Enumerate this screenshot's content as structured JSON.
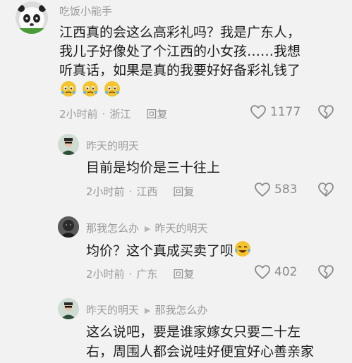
{
  "comments": [
    {
      "user": "吃饭小能手",
      "lines": [
        "江西真的会这么高彩礼吗？我是广东人，",
        "我儿子好像处了个江西的小女孩……我想",
        "听真话，如果是真的我要好好备彩礼钱了"
      ],
      "emoji_names": [
        "worried-face-emoji",
        "worried-face-emoji",
        "worried-face-emoji"
      ],
      "time": "2小时前",
      "location": "浙江",
      "reply": "回复",
      "likes": "1177"
    },
    {
      "user": "昨天的明天",
      "lines": [
        "目前是均价是三十往上"
      ],
      "time": "2小时前",
      "location": "江西",
      "reply": "回复",
      "likes": "583"
    },
    {
      "user": "那我怎么办",
      "reply_to": "昨天的明天",
      "lines": [
        "均价？这个真成买卖了呗"
      ],
      "emoji_names": [
        "tears-of-joy-emoji"
      ],
      "time": "2小时前",
      "location": "广东",
      "reply": "回复",
      "likes": "402"
    },
    {
      "user": "昨天的明天",
      "reply_to": "那我怎么办",
      "lines": [
        "这么说吧，要是谁家嫁女只要二十左",
        "右，周围人都会说哇好便宜好心善亲家"
      ]
    }
  ],
  "icons": {
    "like": "heart-outline-icon",
    "dislike": "broken-heart-icon",
    "reply_arrow": "play-triangle-icon"
  },
  "colors": {
    "background": "#f2f2f2",
    "text": "#1c1c1c",
    "secondary": "#9a9a9a"
  }
}
